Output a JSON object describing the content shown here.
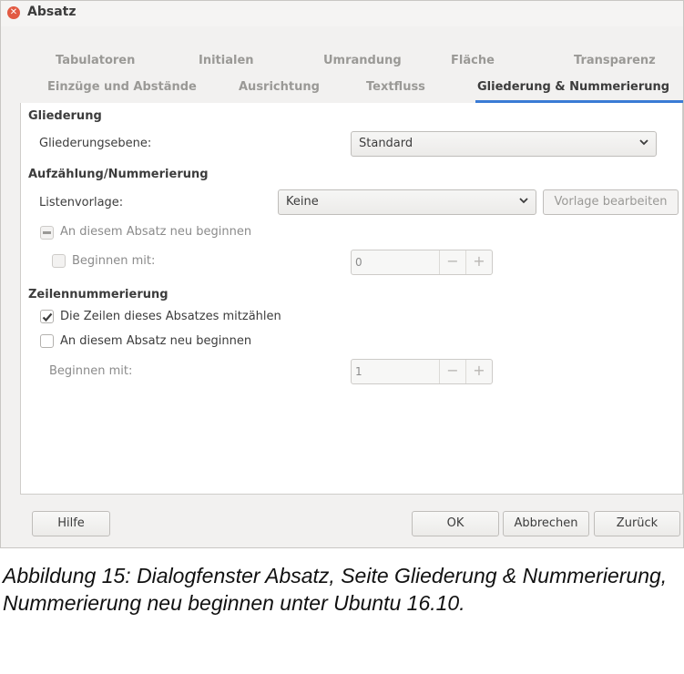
{
  "window": {
    "title": "Absatz",
    "close_icon": "close-icon"
  },
  "tabs_row1": [
    "Tabulatoren",
    "Initialen",
    "Umrandung",
    "Fläche",
    "Transparenz"
  ],
  "tabs_row2": [
    "Einzüge und Abstände",
    "Ausrichtung",
    "Textfluss",
    "Gliederung & Nummerierung"
  ],
  "active_tab": "Gliederung & Nummerierung",
  "outline": {
    "heading": "Gliederung",
    "level_label": "Gliederungsebene:",
    "level_value": "Standard"
  },
  "list": {
    "heading": "Aufzählung/Nummerierung",
    "style_label": "Listenvorlage:",
    "style_value": "Keine",
    "edit_style_button": "Vorlage bearbeiten",
    "restart_label": "An diesem Absatz neu beginnen",
    "restart_state": "indeterminate",
    "start_with_label": "Beginnen mit:",
    "start_with_checked": false,
    "start_with_value": "0"
  },
  "line_numbering": {
    "heading": "Zeilennummerierung",
    "count_label": "Die Zeilen dieses Absatzes mitzählen",
    "count_checked": true,
    "restart_label": "An diesem Absatz neu beginnen",
    "restart_checked": false,
    "start_with_label": "Beginnen mit:",
    "start_with_value": "1"
  },
  "footer": {
    "help": "Hilfe",
    "ok": "OK",
    "cancel": "Abbrechen",
    "reset": "Zurück"
  },
  "spin_minus": "−",
  "spin_plus": "+",
  "caption": "Abbildung 15: Dialogfenster Absatz, Seite Gliederung & Nummerierung, Nummerierung neu beginnen unter Ubuntu 16.10.",
  "colors": {
    "accent": "#3a7bd5",
    "close": "#e25a43"
  }
}
